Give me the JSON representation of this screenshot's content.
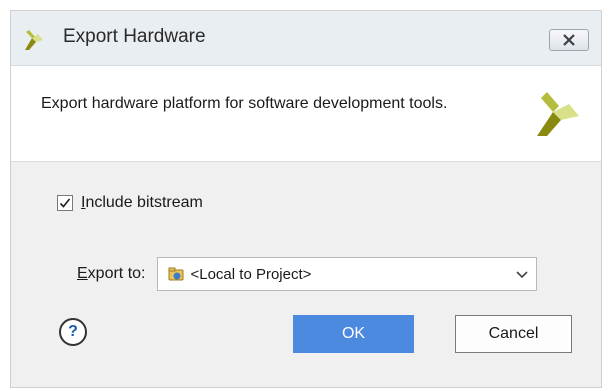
{
  "window": {
    "title": "Export Hardware",
    "close_icon": "close-icon"
  },
  "header": {
    "description": "Export hardware platform for software development tools.",
    "logo": "xilinx-logo"
  },
  "options": {
    "include_bitstream": {
      "mnemonic": "I",
      "label_rest": "nclude bitstream",
      "checked": true
    },
    "export_to": {
      "mnemonic": "E",
      "label_rest": "xport to:",
      "value": "<Local to Project>",
      "icon": "folder-icon"
    }
  },
  "buttons": {
    "help": "?",
    "ok": "OK",
    "cancel": "Cancel"
  },
  "colors": {
    "ok_button": "#4c8ae0",
    "titlebar": "#e9eef3",
    "logo_dark": "#8a8a10",
    "logo_light": "#d9e08a"
  }
}
